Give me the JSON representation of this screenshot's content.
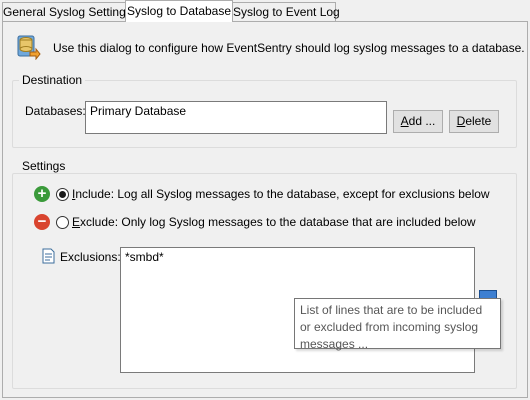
{
  "tabs": [
    {
      "label": "General Syslog Settings",
      "active": false
    },
    {
      "label": "Syslog to Database",
      "active": true
    },
    {
      "label": "Syslog to Event Log",
      "active": false
    }
  ],
  "intro": {
    "icon": "syslog-database-icon",
    "text": "Use this dialog to configure how EventSentry should log syslog messages to a database."
  },
  "destination": {
    "legend": "Destination",
    "databases_label": "Databases:",
    "databases_value": "Primary Database",
    "add_button": {
      "mnemonic": "A",
      "rest": "dd ..."
    },
    "delete_button": {
      "mnemonic": "D",
      "rest": "elete"
    }
  },
  "settings": {
    "legend": "Settings",
    "include": {
      "icon": "plus-circle-icon",
      "mnemonic": "I",
      "text": "nclude: Log all Syslog messages to the database, except for exclusions below",
      "selected": true
    },
    "exclude": {
      "icon": "minus-circle-icon",
      "mnemonic": "E",
      "text": "xclude: Only log Syslog messages to the database that are included below",
      "selected": false
    },
    "exclusions_label": "Exclusions:",
    "exclusions_value": "*smbd*",
    "tooltip": "List of lines that are to be included or excluded from incoming syslog messages ..."
  },
  "colors": {
    "include_icon": "#3a9a3a",
    "exclude_icon": "#d9442e",
    "tooltip_text": "#575757"
  }
}
